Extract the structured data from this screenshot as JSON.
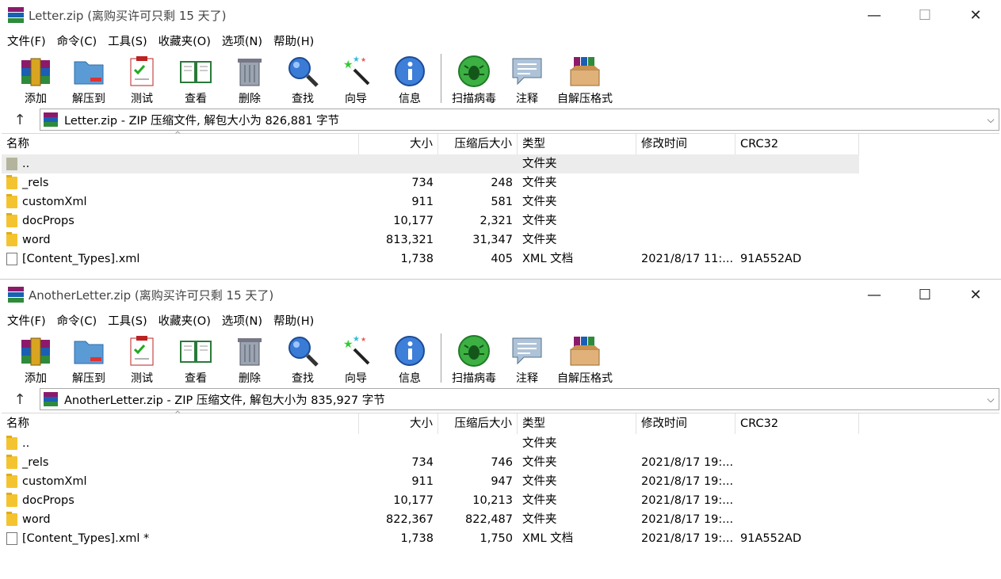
{
  "windows": [
    {
      "title": "Letter.zip (离购买许可只剩 15 天了)",
      "controls": {
        "minimize": "—",
        "maximize": "☐",
        "close": "✕"
      },
      "menu": [
        "文件(F)",
        "命令(C)",
        "工具(S)",
        "收藏夹(O)",
        "选项(N)",
        "帮助(H)"
      ],
      "toolbar": [
        "添加",
        "解压到",
        "测试",
        "查看",
        "删除",
        "查找",
        "向导",
        "信息",
        "扫描病毒",
        "注释",
        "自解压格式"
      ],
      "path": "Letter.zip - ZIP 压缩文件, 解包大小为 826,881 字节",
      "columns": {
        "name": "名称",
        "size": "大小",
        "packed": "压缩后大小",
        "type": "类型",
        "modified": "修改时间",
        "crc": "CRC32"
      },
      "rows": [
        {
          "name": "..",
          "size": "",
          "packed": "",
          "type": "文件夹",
          "modified": "",
          "crc": ""
        },
        {
          "name": "_rels",
          "size": "734",
          "packed": "248",
          "type": "文件夹",
          "modified": "",
          "crc": ""
        },
        {
          "name": "customXml",
          "size": "911",
          "packed": "581",
          "type": "文件夹",
          "modified": "",
          "crc": ""
        },
        {
          "name": "docProps",
          "size": "10,177",
          "packed": "2,321",
          "type": "文件夹",
          "modified": "",
          "crc": ""
        },
        {
          "name": "word",
          "size": "813,321",
          "packed": "31,347",
          "type": "文件夹",
          "modified": "",
          "crc": ""
        },
        {
          "name": "[Content_Types].xml",
          "size": "1,738",
          "packed": "405",
          "type": "XML 文档",
          "modified": "2021/8/17 11:...",
          "crc": "91A552AD"
        }
      ]
    },
    {
      "title": "AnotherLetter.zip (离购买许可只剩 15 天了)",
      "controls": {
        "minimize": "—",
        "maximize": "☐",
        "close": "✕"
      },
      "menu": [
        "文件(F)",
        "命令(C)",
        "工具(S)",
        "收藏夹(O)",
        "选项(N)",
        "帮助(H)"
      ],
      "toolbar": [
        "添加",
        "解压到",
        "测试",
        "查看",
        "删除",
        "查找",
        "向导",
        "信息",
        "扫描病毒",
        "注释",
        "自解压格式"
      ],
      "path": "AnotherLetter.zip - ZIP 压缩文件, 解包大小为 835,927 字节",
      "columns": {
        "name": "名称",
        "size": "大小",
        "packed": "压缩后大小",
        "type": "类型",
        "modified": "修改时间",
        "crc": "CRC32"
      },
      "rows": [
        {
          "name": "..",
          "size": "",
          "packed": "",
          "type": "文件夹",
          "modified": "",
          "crc": ""
        },
        {
          "name": "_rels",
          "size": "734",
          "packed": "746",
          "type": "文件夹",
          "modified": "2021/8/17 19:...",
          "crc": ""
        },
        {
          "name": "customXml",
          "size": "911",
          "packed": "947",
          "type": "文件夹",
          "modified": "2021/8/17 19:...",
          "crc": ""
        },
        {
          "name": "docProps",
          "size": "10,177",
          "packed": "10,213",
          "type": "文件夹",
          "modified": "2021/8/17 19:...",
          "crc": ""
        },
        {
          "name": "word",
          "size": "822,367",
          "packed": "822,487",
          "type": "文件夹",
          "modified": "2021/8/17 19:...",
          "crc": ""
        },
        {
          "name": "[Content_Types].xml *",
          "size": "1,738",
          "packed": "1,750",
          "type": "XML 文档",
          "modified": "2021/8/17 19:...",
          "crc": "91A552AD"
        }
      ]
    }
  ],
  "icons": {
    "toolbar": [
      "add-archive-icon",
      "extract-to-icon",
      "test-icon",
      "view-icon",
      "delete-icon",
      "find-icon",
      "wizard-icon",
      "info-icon",
      "scan-virus-icon",
      "comment-icon",
      "sfx-icon"
    ],
    "up": "↑",
    "dropdown": "⌵",
    "sort": "^"
  }
}
